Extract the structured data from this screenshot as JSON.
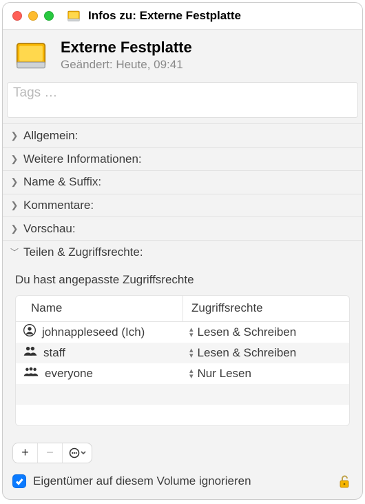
{
  "titlebar": {
    "title": "Infos zu: Externe Festplatte"
  },
  "header": {
    "name": "Externe Festplatte",
    "modified": "Geändert: Heute, 09:41"
  },
  "tags": {
    "placeholder": "Tags …"
  },
  "sections": [
    {
      "label": "Allgemein:",
      "expanded": false
    },
    {
      "label": "Weitere Informationen:",
      "expanded": false
    },
    {
      "label": "Name & Suffix:",
      "expanded": false
    },
    {
      "label": "Kommentare:",
      "expanded": false
    },
    {
      "label": "Vorschau:",
      "expanded": false
    },
    {
      "label": "Teilen & Zugriffsrechte:",
      "expanded": true
    }
  ],
  "permissions": {
    "custom_note": "Du hast angepasste Zugriffsrechte",
    "col_name": "Name",
    "col_priv": "Zugriffsrechte",
    "rows": [
      {
        "user": "johnappleseed (Ich)",
        "priv": "Lesen & Schreiben",
        "icon": "person"
      },
      {
        "user": "staff",
        "priv": "Lesen & Schreiben",
        "icon": "group2"
      },
      {
        "user": "everyone",
        "priv": "Nur Lesen",
        "icon": "group3"
      }
    ]
  },
  "toolbar": {
    "add": "+",
    "remove": "−",
    "action": "⊙"
  },
  "footer": {
    "ignore_ownership_label": "Eigentümer auf diesem Volume ignorieren",
    "ignore_ownership_checked": true
  }
}
